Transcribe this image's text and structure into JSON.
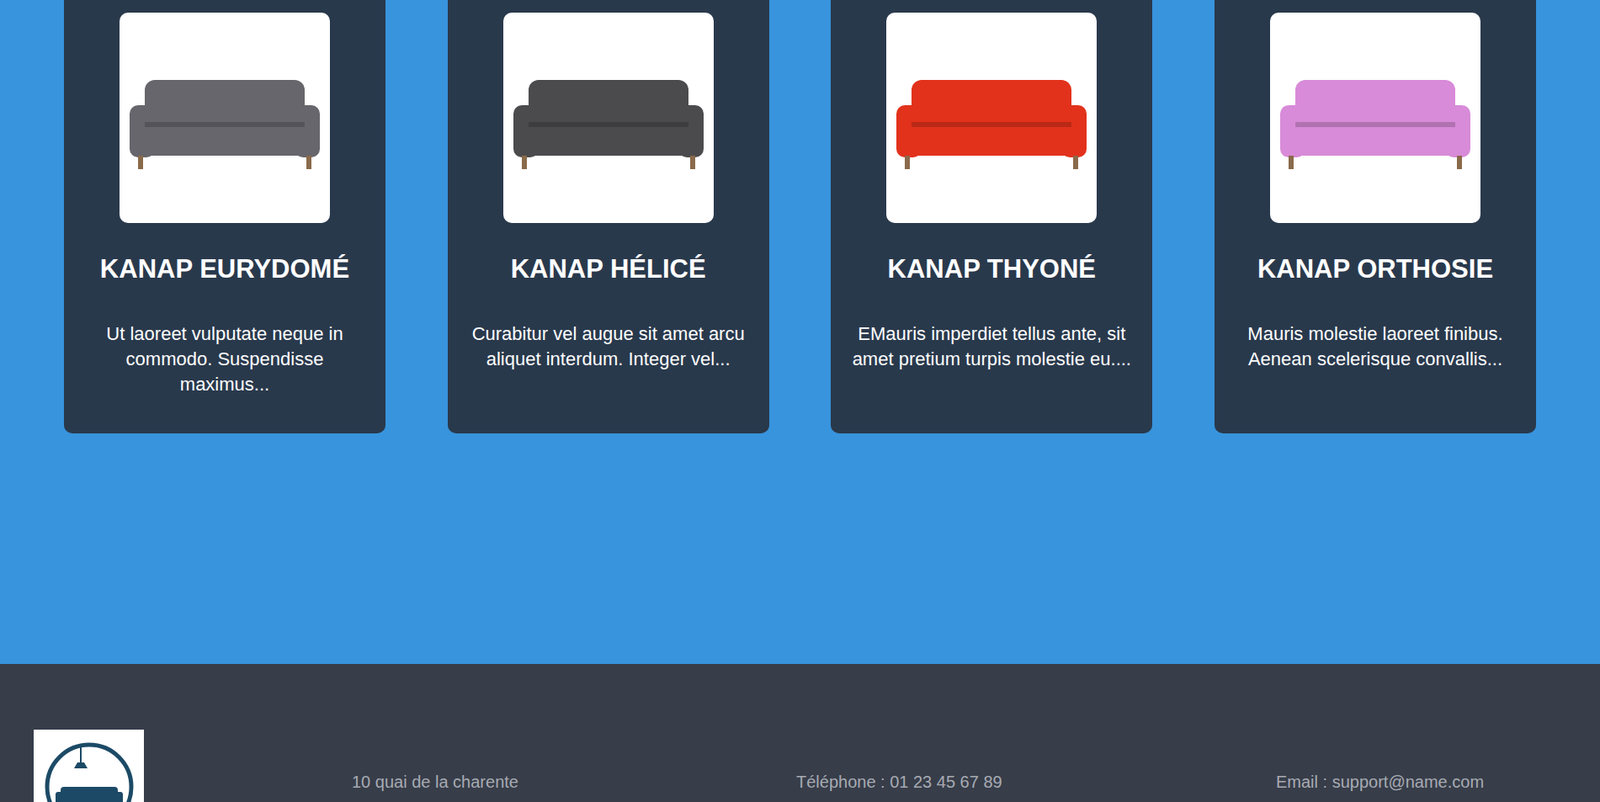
{
  "products": [
    {
      "name": "KANAP EURYDOMÉ",
      "description": "Ut laoreet vulputate neque in commodo. Suspendisse maximus...",
      "color": "#66666c"
    },
    {
      "name": "KANAP HÉLICÉ",
      "description": "Curabitur vel augue sit amet arcu aliquet interdum. Integer vel...",
      "color": "#4b4b4d"
    },
    {
      "name": "KANAP THYONÉ",
      "description": "EMauris imperdiet tellus ante, sit amet pretium turpis molestie eu....",
      "color": "#e2321c"
    },
    {
      "name": "KANAP ORTHOSIE",
      "description": "Mauris molestie laoreet finibus. Aenean scelerisque convallis...",
      "color": "#d88bd8"
    }
  ],
  "footer": {
    "address": "10 quai de la charente",
    "phone": "Téléphone : 01 23 45 67 89",
    "email": "Email : support@name.com"
  }
}
